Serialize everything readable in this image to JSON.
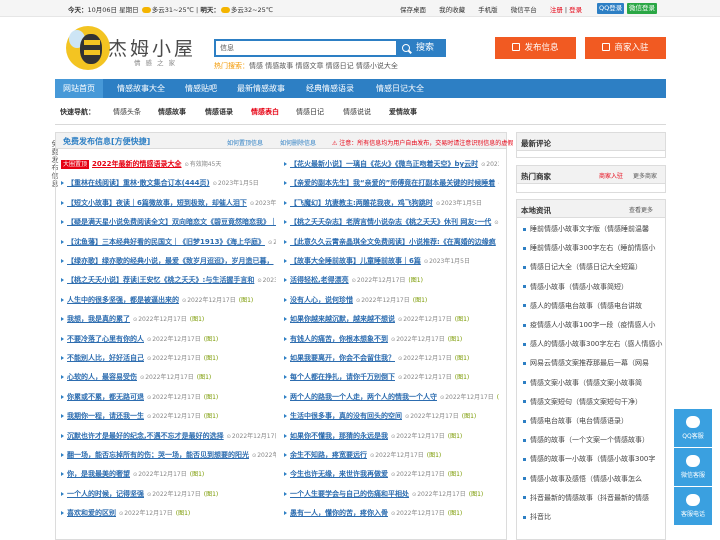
{
  "topbar": {
    "today_label": "今天：",
    "date": "10月06日 星期日",
    "weather_today": "多云31~25℃",
    "tomorrow_label": "明天：",
    "weather_tomorrow": "多云32~25℃",
    "links": [
      "保存桌面",
      "我的收藏",
      "手机版",
      "微信平台"
    ],
    "register": "注册",
    "login": "登录",
    "qq_login": "QQ登录",
    "wechat_login": "微信登录"
  },
  "header": {
    "site_name": "杰姆小屋",
    "site_sub": "情感之家",
    "search_select": "信息",
    "search_button": "搜索",
    "hot_label": "热门搜索：",
    "hot_words": "情感 情感故事 情感文章 情感日记 情感小说大全",
    "publish_button": "发布信息",
    "join_button": "商家入驻"
  },
  "nav": {
    "items": [
      "网站首页",
      "情感故事大全",
      "情感贴吧",
      "最新情感故事",
      "经典情感语录",
      "情感日记大全"
    ]
  },
  "quicknav": {
    "label": "快速导航：",
    "items": [
      "情感头条",
      "情感故事",
      "情感语录",
      "情感表白",
      "情感日记",
      "情感说说",
      "爱情故事"
    ]
  },
  "left": {
    "title": "免费发布信息[方便快捷]",
    "action_publish": "如何置顶信息",
    "action_delete": "如何删除信息",
    "notice": "⚠ 注意：所有信息均为用户自由发布，交易时请注意识别信息的虚假",
    "top_tag": "大圈置顶",
    "top_title": "2022年最新的情感语录大全",
    "top_meta": "有效期45天",
    "col1": [
      {
        "title": "【重林在线阅读】重林·散文集合订本(444页)",
        "date": "2023年1月5日"
      },
      {
        "title": "【短文小故事】夜读｜6篇微故事，短到极致，却催人泪下",
        "date": "2023年1月5日"
      },
      {
        "title": "【疑是满天星小说免费阅读全文】双向暗恋文《碧豆竟然暗恋我》｜",
        "date": "2023年1月5日"
      },
      {
        "title": "【沈鱼藩】三本经典好看的民国文｜《旧梦1913》《海上华庭》",
        "date": "2023年1月5日"
      },
      {
        "title": "【绿亦歌】绿亦歌的经典小说，最爱《致岁月迢迢》，岁月造已暮，",
        "date": "2023年1月5日"
      },
      {
        "title": "【桃之夭夭小说】荐读|王安忆《桃之夭夭》:与生活握手言和",
        "date": "2023年1月5日"
      },
      {
        "title": "人生中的很多坚强，都是被逼出来的",
        "date": "2022年12月17日"
      },
      {
        "title": "我想，我是真的累了",
        "date": "2022年12月17日"
      },
      {
        "title": "不要冷落了心里有你的人",
        "date": "2022年12月17日"
      },
      {
        "title": "不能别人比，好好活自己",
        "date": "2022年12月17日"
      },
      {
        "title": "心软的人，最容易受伤",
        "date": "2022年12月17日"
      },
      {
        "title": "你累或不累，都无路可退",
        "date": "2022年12月17日"
      },
      {
        "title": "我期你一程，请还我一生",
        "date": "2022年12月17日"
      },
      {
        "title": "沉默也许才是最好的纪念,不遇不忘才是最好的选择",
        "date": "2022年12月17日"
      },
      {
        "title": "翻一场，能否忘掉所有的伤；哭一场，能否见到想要的阳光",
        "date": "2022年12月17日"
      },
      {
        "title": "你，是我最美的奢望",
        "date": "2022年12月17日"
      },
      {
        "title": "一个人的时候，记得坚强",
        "date": "2022年12月17日"
      },
      {
        "title": "喜欢和爱的区别",
        "date": "2022年12月17日"
      }
    ],
    "col2": [
      {
        "title": "【花火最新小说】一璃自《花火》《微鸟正吻着天空》by云时",
        "date": "2023年1月5日"
      },
      {
        "title": "【亲爱的副本先生】我“亲爱的”师傅竟在打副本最关键的时候睡着",
        "date": "2023年1月5日"
      },
      {
        "title": "【飞魔幻】坑妻教主:两雕花我夜，鸡飞狗跳时",
        "date": "2023年1月5日"
      },
      {
        "title": "【桃之夭夭杂志】老牌言情小说杂志《桃之夭夭》休刊 网友:一代",
        "date": "2023年1月5日"
      },
      {
        "title": "【此意久久云霄亲晶琪全文免费阅读】小说推荐:《在离婚的边缘疯",
        "date": "2023年1月5日"
      },
      {
        "title": "【故事大全睡前故事】儿童睡前故事｜6篇",
        "date": "2023年1月5日"
      },
      {
        "title": "活得轻松,老得漂亮",
        "date": "2022年12月17日"
      },
      {
        "title": "没有人心，说何珍惜",
        "date": "2022年12月17日"
      },
      {
        "title": "如果你越来越沉默，越来越不想说",
        "date": "2022年12月17日"
      },
      {
        "title": "有钱人的痛苦，你根本想象不到",
        "date": "2022年12月17日"
      },
      {
        "title": "如果我要离开，你会不会留住我？",
        "date": "2022年12月17日"
      },
      {
        "title": "每个人都在挣扎，请你千万别倒下",
        "date": "2022年12月17日"
      },
      {
        "title": "两个人的路我一个人走，两个人的情我一个人守",
        "date": "2022年12月17日"
      },
      {
        "title": "生活中很多事，真的没有回头的空间",
        "date": "2022年12月17日"
      },
      {
        "title": "如果你不懂我，那猜的永远是我",
        "date": "2022年12月17日"
      },
      {
        "title": "余生不知路，疼宽要远行",
        "date": "2022年12月17日"
      },
      {
        "title": "今生也许无缘，来世许我再做爱",
        "date": "2022年12月17日"
      },
      {
        "title": "一个人生要学会与自己的伤痛和平相处",
        "date": "2022年12月17日"
      },
      {
        "title": "愚有一人，懂你的苦，疼你入骨",
        "date": "2022年12月17日"
      }
    ]
  },
  "right": {
    "comments_title": "最新评论",
    "merchants_title": "热门商家",
    "merchant_join": "商家入驻",
    "merchant_more": "更多商家",
    "local_title": "本地资讯",
    "local_more": "查看更多",
    "local_items": [
      "睡前情感小故事文字版（情感睡前温馨",
      "睡前情感小故事300字左右（睡前情感小",
      "情感日记大全（情感日记大全短篇）",
      "情感小故事（情感小故事简短）",
      "感人的情感电台故事（情感电台讲故",
      "疫情感人小故事100字一段（疫情感人小",
      "感人的情感小故事300字左右（感人情感小",
      "网易云情感文案推荐那最后一幕（网易",
      "情感文案小故事（情感文案小故事简",
      "情感文案短句（情感文案短句干净）",
      "情感电台故事（电台情感语录）",
      "情感的故事（一个文案一个情感故事）",
      "情感的故事一小故事（情感小故事300字",
      "情感小故事及感悟（情感小故事怎么",
      "抖音最新的情感故事（抖音最新的情感",
      "抖音比"
    ]
  },
  "float": {
    "qq": "QQ客服",
    "wechat": "微信客服",
    "phone": "客服电话"
  },
  "deco_text": "免费发布信息"
}
